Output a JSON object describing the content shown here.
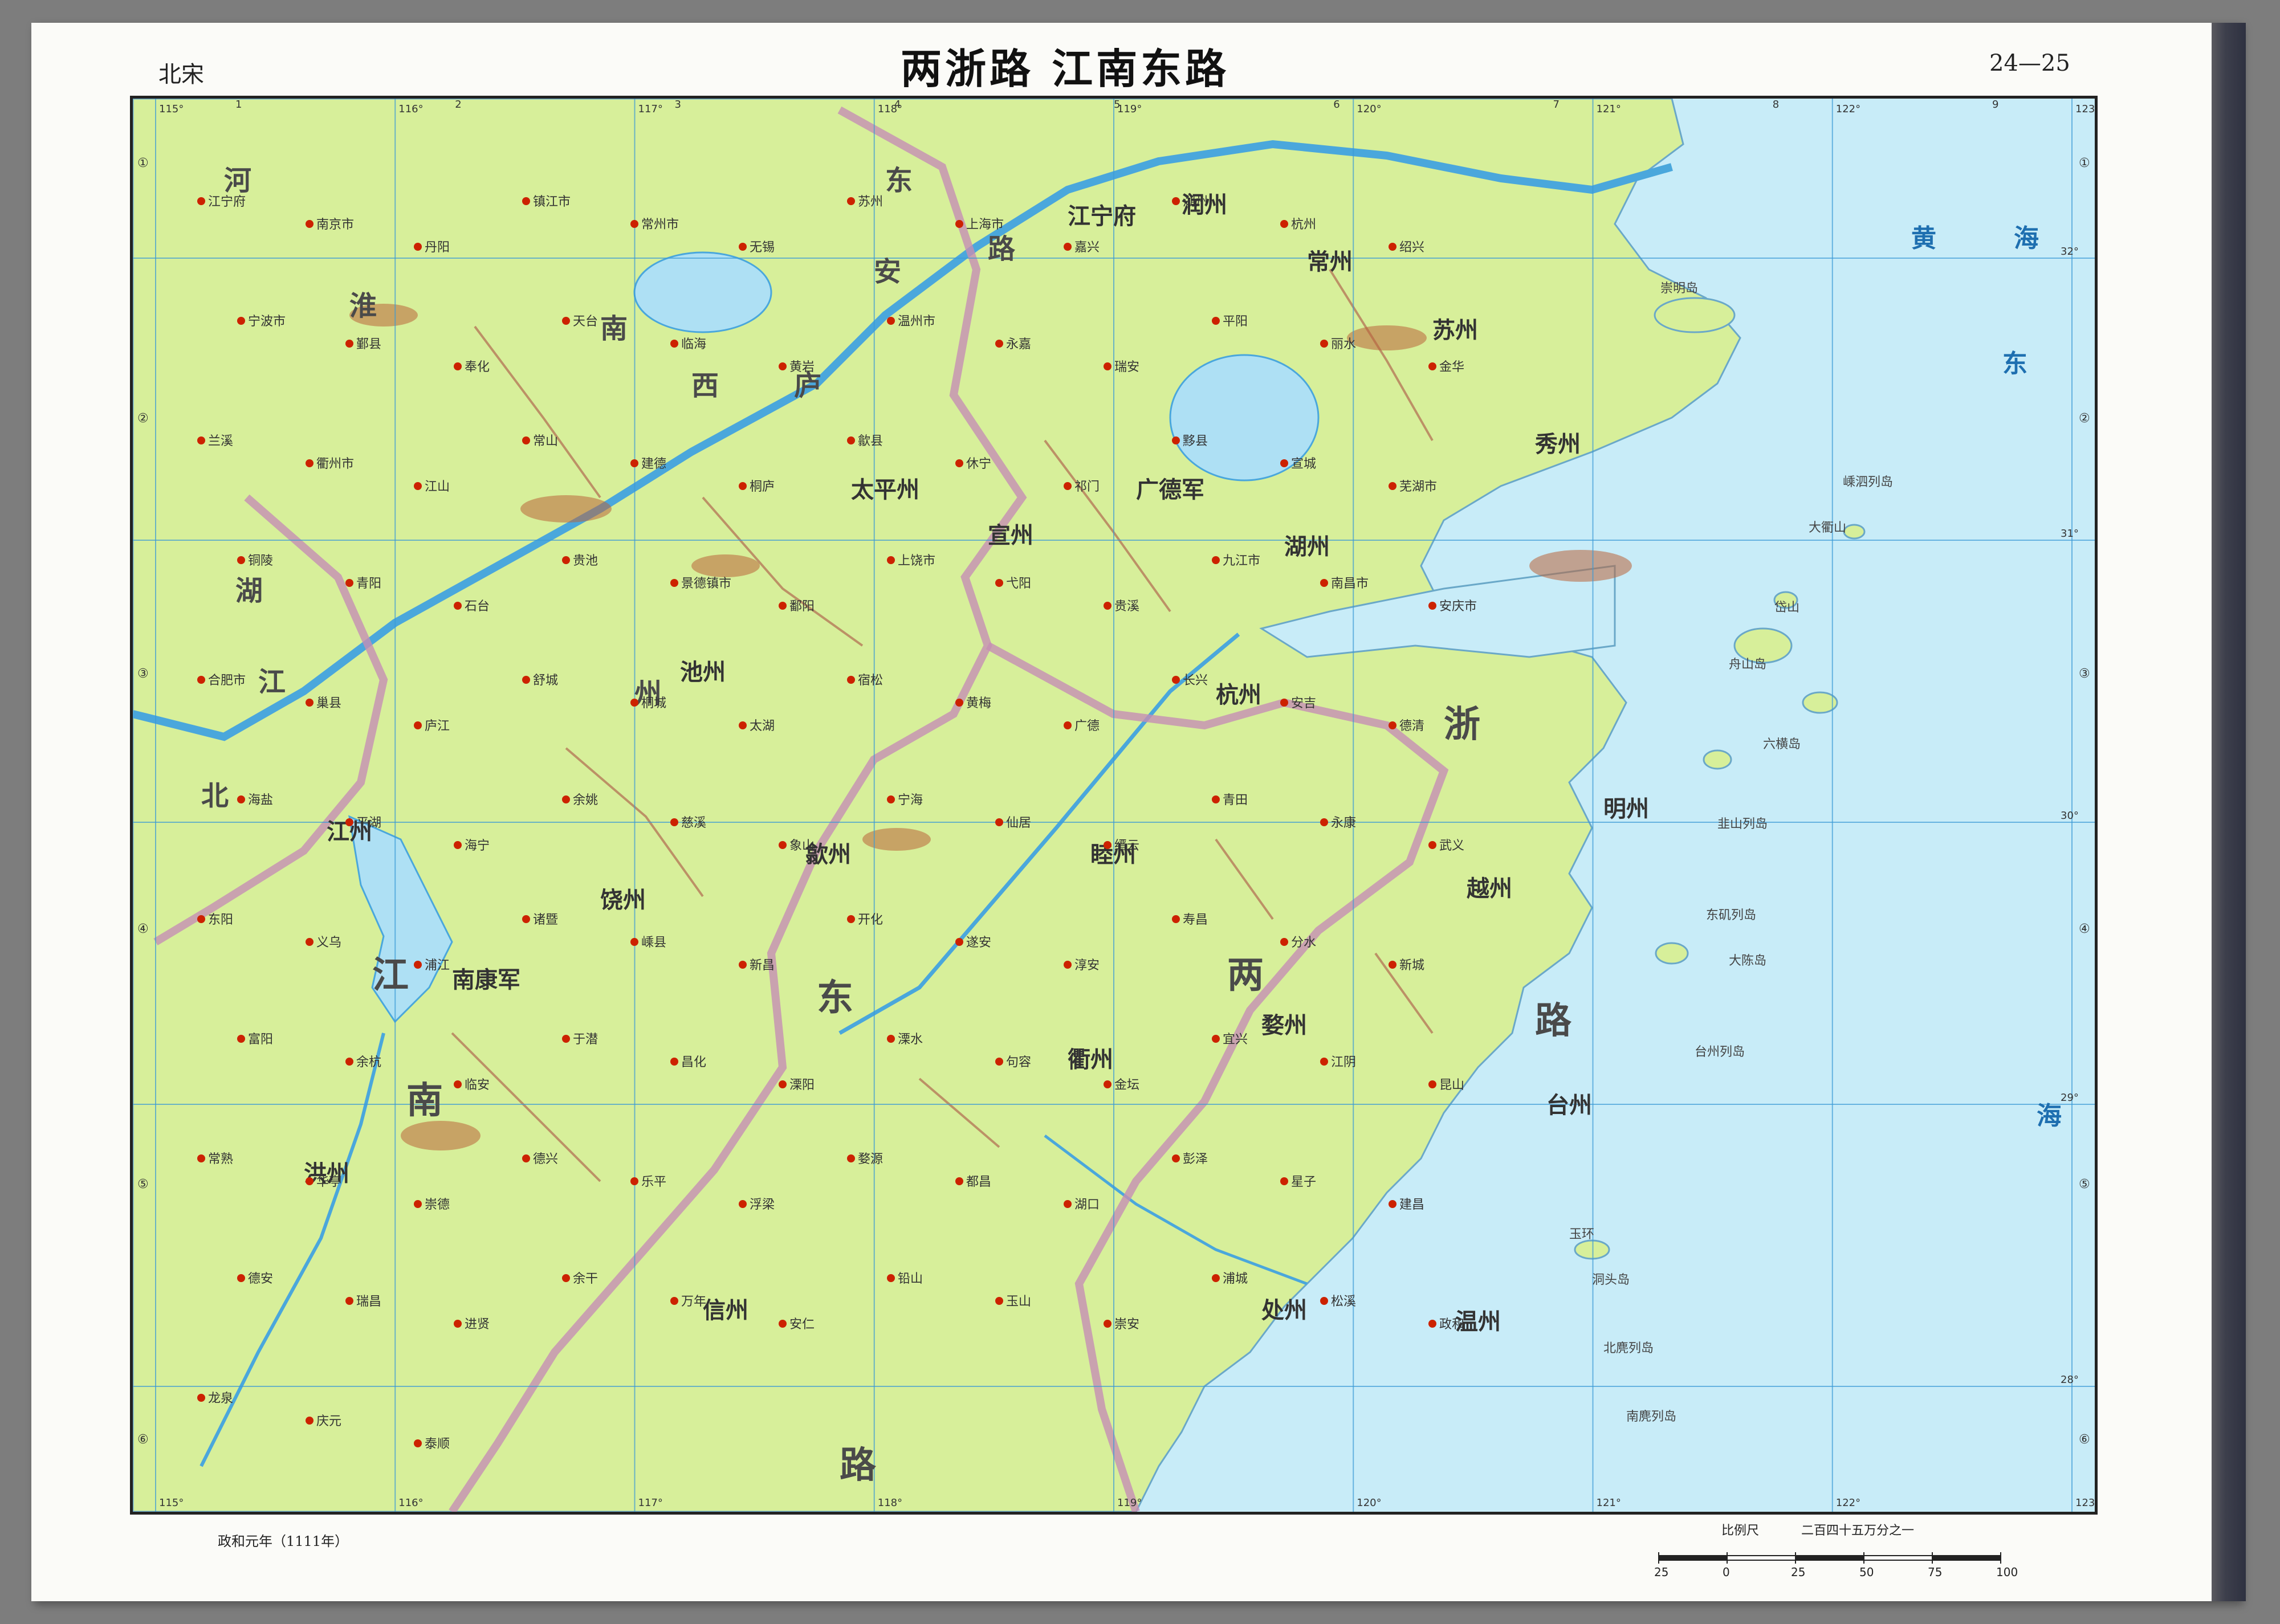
{
  "header": {
    "era": "北宋",
    "title": "两浙路 江南东路",
    "page_range": "24—25"
  },
  "footer": {
    "date_note": "政和元年（1111年）",
    "scale_label": "比例尺",
    "scale_ratio": "二百四十五万分之一",
    "scale_ticks": [
      "25",
      "0",
      "25",
      "50",
      "75",
      "100公里"
    ]
  },
  "map": {
    "colors": {
      "land": "#d7ef9a",
      "sea": "#c8ecf8",
      "lake": "#aee0f4",
      "river": "#4aa7dc",
      "circuit_border": "#c58fb4",
      "prefecture_border": "#b06a50",
      "mountain": "#b9643a",
      "city": "#cc2200",
      "grid": "#3a9ad6"
    },
    "circuit_labels": [
      "两",
      "浙",
      "路",
      "江",
      "南",
      "东",
      "路"
    ],
    "region_labels": [
      {
        "text": "淮",
        "role": "circuit"
      },
      {
        "text": "南",
        "role": "circuit"
      },
      {
        "text": "东",
        "role": "circuit"
      },
      {
        "text": "路",
        "role": "circuit"
      },
      {
        "text": "河",
        "role": "circuit"
      },
      {
        "text": "安",
        "role": "circuit"
      },
      {
        "text": "庐",
        "role": "circuit"
      },
      {
        "text": "西",
        "role": "circuit"
      },
      {
        "text": "湖",
        "role": "circuit"
      },
      {
        "text": "北",
        "role": "circuit"
      },
      {
        "text": "江",
        "role": "circuit"
      },
      {
        "text": "州",
        "role": "circuit"
      }
    ],
    "prefectures": [
      {
        "text": "苏州",
        "key": "suzhou"
      },
      {
        "text": "常州",
        "key": "changzhou"
      },
      {
        "text": "湖州",
        "key": "huzhou"
      },
      {
        "text": "秀州",
        "key": "xiuzhou"
      },
      {
        "text": "杭州",
        "key": "hangzhou"
      },
      {
        "text": "睦州",
        "key": "muzhou"
      },
      {
        "text": "越州",
        "key": "yuezhou"
      },
      {
        "text": "明州",
        "key": "mingzhou"
      },
      {
        "text": "婺州",
        "key": "wuzhou"
      },
      {
        "text": "衢州",
        "key": "quzhou"
      },
      {
        "text": "台州",
        "key": "taizhou"
      },
      {
        "text": "处州",
        "key": "chuzhou"
      },
      {
        "text": "温州",
        "key": "wenzhou"
      },
      {
        "text": "歙州",
        "key": "shezhou"
      },
      {
        "text": "宣州",
        "key": "xuanzhou"
      },
      {
        "text": "池州",
        "key": "chizhou"
      },
      {
        "text": "饶州",
        "key": "raozhou"
      },
      {
        "text": "信州",
        "key": "xinzhou"
      },
      {
        "text": "江州",
        "key": "jiangzhou"
      },
      {
        "text": "洪州",
        "key": "hongzhou"
      },
      {
        "text": "南康军",
        "key": "nankangjun"
      },
      {
        "text": "广德军",
        "key": "guangdejun"
      },
      {
        "text": "太平州",
        "key": "taipingzhou"
      },
      {
        "text": "江宁府",
        "key": "jiangning"
      },
      {
        "text": "润州",
        "key": "runzhou"
      }
    ],
    "sea_labels": [
      "黄",
      "海",
      "东",
      "海"
    ],
    "cities": [
      "江宁府",
      "南京市",
      "丹阳",
      "镇江市",
      "常州市",
      "无锡",
      "苏州",
      "上海市",
      "嘉兴",
      "湖州",
      "杭州",
      "绍兴",
      "宁波市",
      "鄞县",
      "奉化",
      "天台",
      "临海",
      "黄岩",
      "温州市",
      "永嘉",
      "瑞安",
      "平阳",
      "丽水",
      "金华",
      "兰溪",
      "衢州市",
      "江山",
      "常山",
      "建德",
      "桐庐",
      "歙县",
      "休宁",
      "祁门",
      "黟县",
      "宣城",
      "芜湖市",
      "铜陵",
      "青阳",
      "石台",
      "贵池",
      "景德镇市",
      "鄱阳",
      "上饶市",
      "弋阳",
      "贵溪",
      "九江市",
      "南昌市",
      "安庆市",
      "合肥市",
      "巢县",
      "庐江",
      "舒城",
      "桐城",
      "太湖",
      "宿松",
      "黄梅",
      "广德",
      "长兴",
      "安吉",
      "德清",
      "海盐",
      "平湖",
      "海宁",
      "余姚",
      "慈溪",
      "象山",
      "宁海",
      "仙居",
      "缙云",
      "青田",
      "永康",
      "武义",
      "东阳",
      "义乌",
      "浦江",
      "诸暨",
      "嵊县",
      "新昌",
      "开化",
      "遂安",
      "淳安",
      "寿昌",
      "分水",
      "新城",
      "富阳",
      "余杭",
      "临安",
      "于潜",
      "昌化",
      "溧阳",
      "溧水",
      "句容",
      "金坛",
      "宜兴",
      "江阴",
      "昆山",
      "常熟",
      "华亭",
      "崇德",
      "德兴",
      "乐平",
      "浮梁",
      "婺源",
      "都昌",
      "湖口",
      "彭泽",
      "星子",
      "建昌",
      "德安",
      "瑞昌",
      "进贤",
      "余干",
      "万年",
      "安仁",
      "铅山",
      "玉山",
      "崇安",
      "浦城",
      "松溪",
      "政和",
      "龙泉",
      "庆元",
      "泰顺"
    ],
    "islands": [
      "崇明岛",
      "舟山岛",
      "岱山",
      "大衢山",
      "嵊泗列岛",
      "六横岛",
      "韭山列岛",
      "大陈岛",
      "玉环",
      "洞头岛",
      "北麂列岛",
      "南麂列岛",
      "台州列岛",
      "东矶列岛"
    ],
    "lat_labels": [
      "32°",
      "31°",
      "30°",
      "29°",
      "28°"
    ],
    "lon_labels": [
      "115°",
      "116°",
      "117°",
      "118°",
      "119°",
      "120°",
      "121°",
      "122°",
      "123°"
    ],
    "col_numbers": [
      "1",
      "2",
      "3",
      "4",
      "5",
      "6",
      "7",
      "8",
      "9"
    ],
    "row_numbers": [
      "①",
      "②",
      "③",
      "④",
      "⑤",
      "⑥"
    ]
  }
}
